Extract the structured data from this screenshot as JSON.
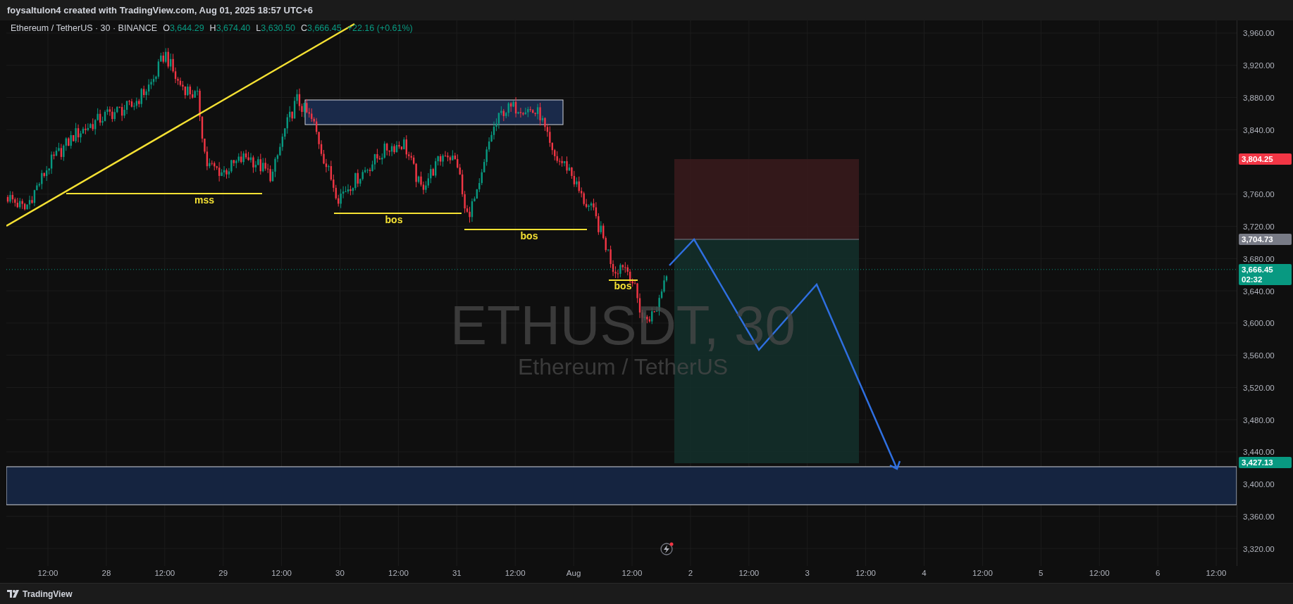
{
  "header": {
    "text": "foysaltulon4 created with TradingView.com, Aug 01, 2025 18:57 UTC+6"
  },
  "legend": {
    "symbol": "Ethereum / TetherUS · 30 · BINANCE",
    "values": [
      {
        "key": "O",
        "value": "3,644.29"
      },
      {
        "key": "H",
        "value": "3,674.40"
      },
      {
        "key": "L",
        "value": "3,630.50"
      },
      {
        "key": "C",
        "value": "3,666.45"
      }
    ],
    "change": "+22.16 (+0.61%)"
  },
  "watermark": {
    "symbol": "ETHUSDT, 30",
    "description": "Ethereum / TetherUS"
  },
  "annotations": [
    {
      "text": "mss"
    },
    {
      "text": "bos"
    },
    {
      "text": "bos"
    },
    {
      "text": "bos"
    }
  ],
  "price_axis": {
    "ticks": [
      "3,960.00",
      "3,920.00",
      "3,880.00",
      "3,840.00",
      "3,760.00",
      "3,720.00",
      "3,680.00",
      "3,640.00",
      "3,600.00",
      "3,560.00",
      "3,520.00",
      "3,480.00",
      "3,440.00",
      "3,400.00",
      "3,360.00",
      "3,320.00"
    ],
    "markers": [
      {
        "price": "3,804.25",
        "color": "#f23645"
      },
      {
        "price": "3,704.73",
        "color": "#787b86"
      },
      {
        "price": "3,666.45",
        "color": "#089981",
        "countdown": "02:32"
      },
      {
        "price": "3,427.13",
        "color": "#089981"
      }
    ]
  },
  "time_axis": {
    "labels": [
      "12:00",
      "28",
      "12:00",
      "29",
      "12:00",
      "30",
      "12:00",
      "31",
      "12:00",
      "Aug",
      "12:00",
      "2",
      "12:00",
      "3",
      "12:00",
      "4",
      "12:00",
      "5",
      "12:00",
      "6",
      "12:00"
    ]
  },
  "footer": {
    "brand": "TradingView"
  }
}
